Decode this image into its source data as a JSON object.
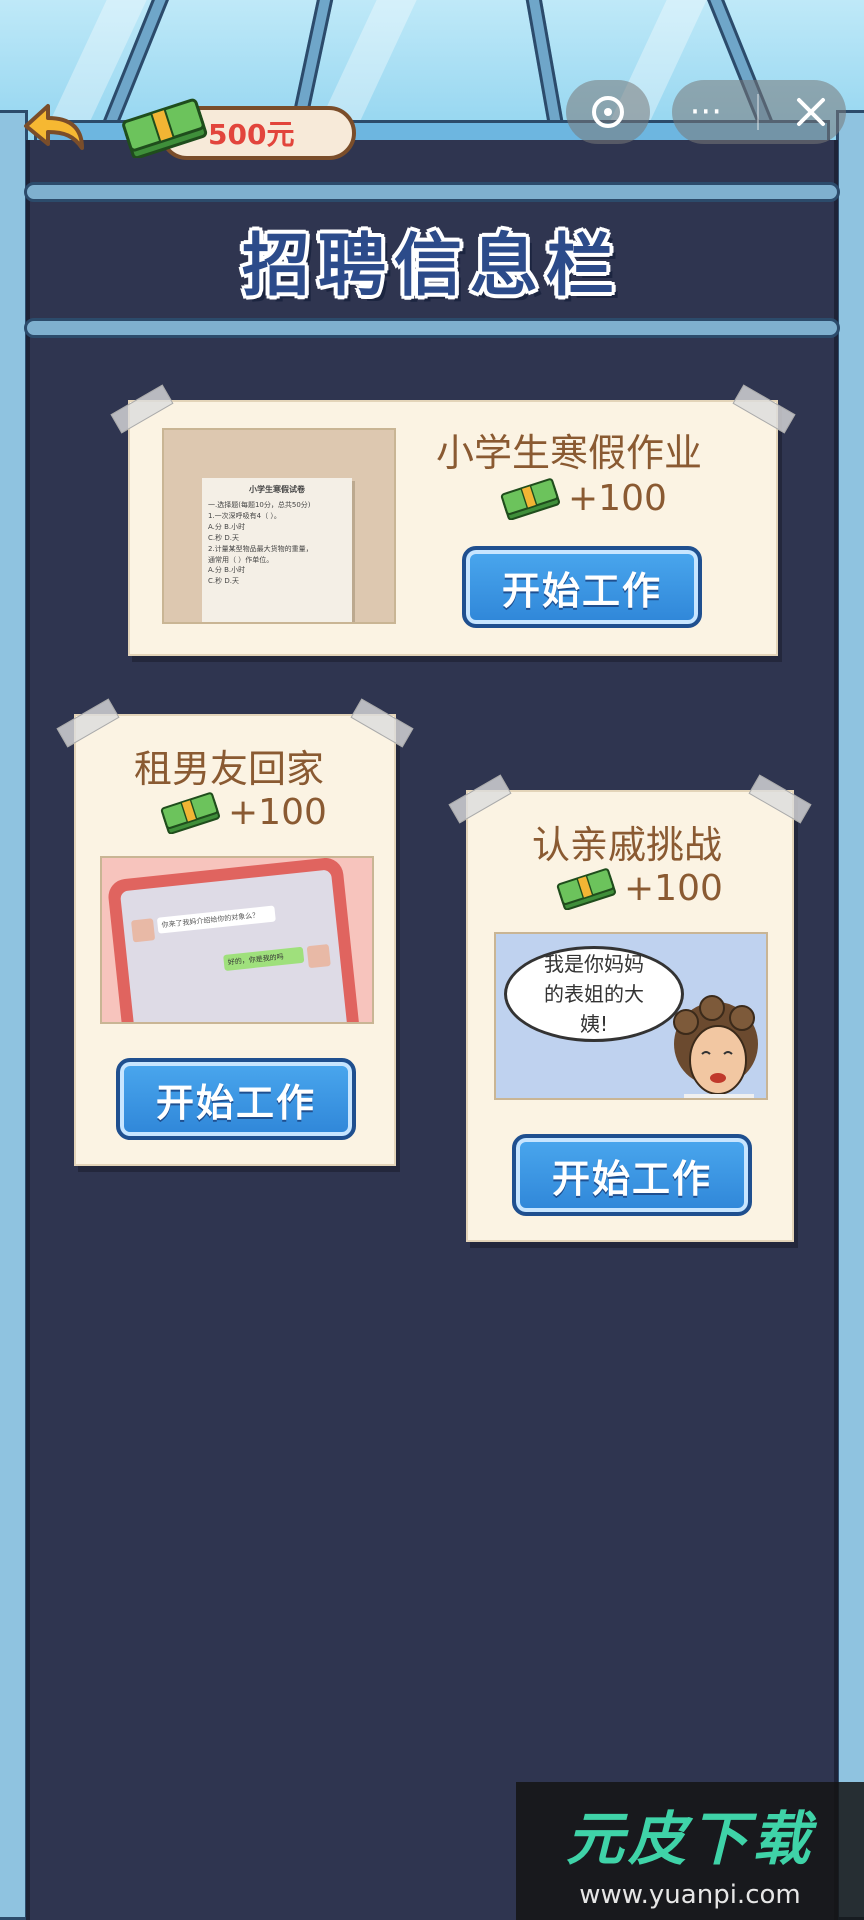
{
  "top_bar": {
    "money": "500元",
    "colors": {
      "money_text": "#e2453c"
    }
  },
  "board": {
    "title": "招聘信息栏"
  },
  "jobs": [
    {
      "title": "小学生寒假作业",
      "reward": "+100",
      "button_label": "开始工作",
      "thumb": {
        "paper_title": "小学生寒假试卷",
        "lines": [
          "一.选择题(每题10分，总共50分)",
          "1.一次深呼吸有4（    ）。",
          "A.分        B.小时",
          "C.秒        D.天",
          "2.计量某型物品最大货物的重量，",
          "   通常用（    ）作单位。",
          "A.分        B.小时",
          "C.秒        D.天"
        ]
      }
    },
    {
      "title": "租男友回家",
      "reward": "+100",
      "button_label": "开始工作",
      "thumb": {
        "chat_left": "你来了我妈介绍给你的对象么？",
        "chat_right": "好的，你是我的吗"
      }
    },
    {
      "title": "认亲戚挑战",
      "reward": "+100",
      "button_label": "开始工作",
      "thumb": {
        "bubble": "我是你妈妈的表姐的大姨!"
      }
    }
  ],
  "watermark": {
    "logo": "元皮下载",
    "url": "www.yuanpi.com"
  }
}
